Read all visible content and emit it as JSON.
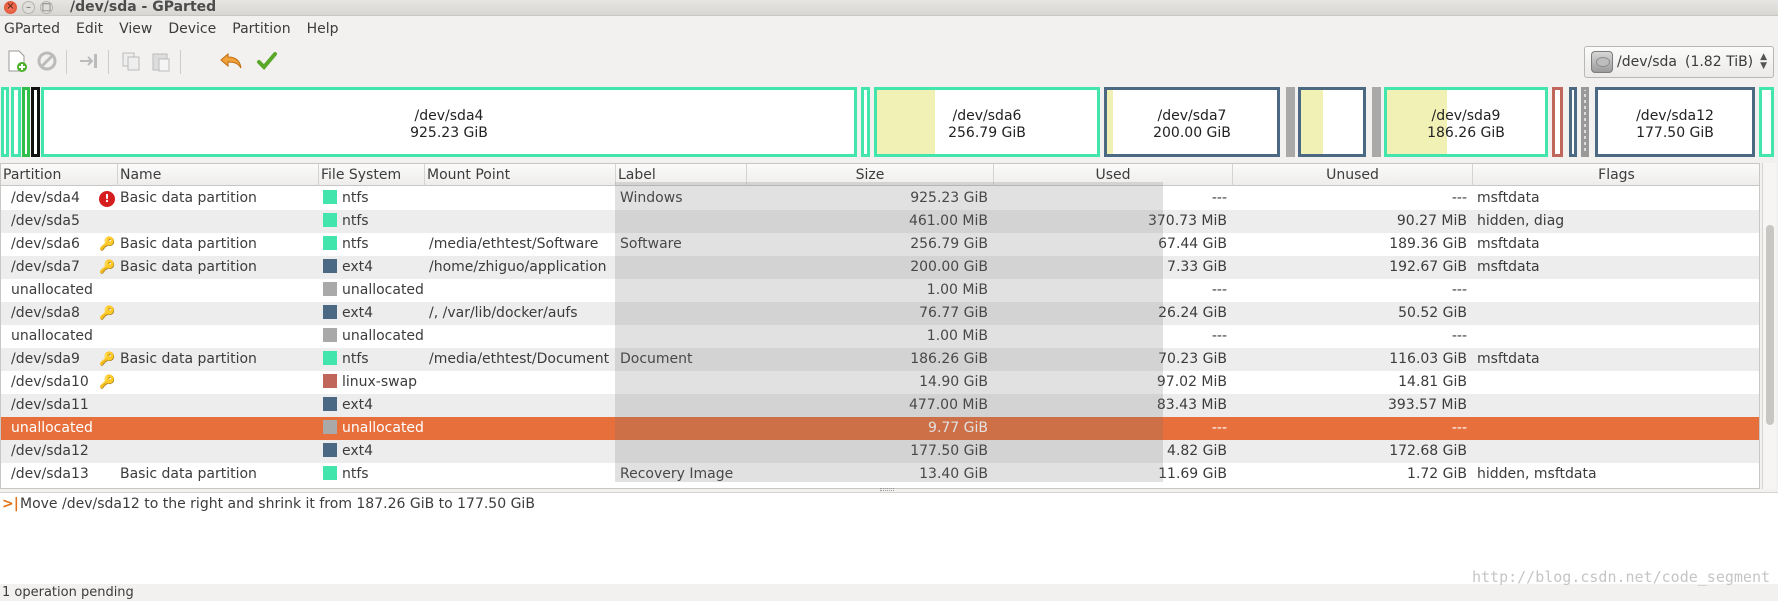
{
  "window": {
    "title": "/dev/sda - GParted"
  },
  "menu": [
    "GParted",
    "Edit",
    "View",
    "Device",
    "Partition",
    "Help"
  ],
  "device": {
    "name": "/dev/sda",
    "size": "(1.82 TiB)"
  },
  "map": {
    "sda4": {
      "name": "/dev/sda4",
      "size": "925.23 GiB"
    },
    "sda6": {
      "name": "/dev/sda6",
      "size": "256.79 GiB"
    },
    "sda7": {
      "name": "/dev/sda7",
      "size": "200.00 GiB"
    },
    "sda9": {
      "name": "/dev/sda9",
      "size": "186.26 GiB"
    },
    "sda12": {
      "name": "/dev/sda12",
      "size": "177.50 GiB"
    }
  },
  "columns": {
    "partition": "Partition",
    "name": "Name",
    "fs": "File System",
    "mount": "Mount Point",
    "label": "Label",
    "size": "Size",
    "used": "Used",
    "unused": "Unused",
    "flags": "Flags"
  },
  "rows": [
    {
      "partition": "/dev/sda4",
      "name": "Basic data partition",
      "fs": "ntfs",
      "mount": "",
      "label": "Windows",
      "size": "925.23 GiB",
      "used": "---",
      "unused": "---",
      "flags": "msftdata"
    },
    {
      "partition": "/dev/sda5",
      "name": "",
      "fs": "ntfs",
      "mount": "",
      "label": "",
      "size": "461.00 MiB",
      "used": "370.73 MiB",
      "unused": "90.27 MiB",
      "flags": "hidden, diag"
    },
    {
      "partition": "/dev/sda6",
      "name": "Basic data partition",
      "fs": "ntfs",
      "mount": "/media/ethtest/Software",
      "label": "Software",
      "size": "256.79 GiB",
      "used": "67.44 GiB",
      "unused": "189.36 GiB",
      "flags": "msftdata"
    },
    {
      "partition": "/dev/sda7",
      "name": "Basic data partition",
      "fs": "ext4",
      "mount": "/home/zhiguo/application",
      "label": "",
      "size": "200.00 GiB",
      "used": "7.33 GiB",
      "unused": "192.67 GiB",
      "flags": "msftdata"
    },
    {
      "partition": "unallocated",
      "name": "",
      "fs": "unallocated",
      "mount": "",
      "label": "",
      "size": "1.00 MiB",
      "used": "---",
      "unused": "---",
      "flags": ""
    },
    {
      "partition": "/dev/sda8",
      "name": "",
      "fs": "ext4",
      "mount": "/, /var/lib/docker/aufs",
      "label": "",
      "size": "76.77 GiB",
      "used": "26.24 GiB",
      "unused": "50.52 GiB",
      "flags": ""
    },
    {
      "partition": "unallocated",
      "name": "",
      "fs": "unallocated",
      "mount": "",
      "label": "",
      "size": "1.00 MiB",
      "used": "---",
      "unused": "---",
      "flags": ""
    },
    {
      "partition": "/dev/sda9",
      "name": "Basic data partition",
      "fs": "ntfs",
      "mount": "/media/ethtest/Document",
      "label": "Document",
      "size": "186.26 GiB",
      "used": "70.23 GiB",
      "unused": "116.03 GiB",
      "flags": "msftdata"
    },
    {
      "partition": "/dev/sda10",
      "name": "",
      "fs": "linux-swap",
      "mount": "",
      "label": "",
      "size": "14.90 GiB",
      "used": "97.02 MiB",
      "unused": "14.81 GiB",
      "flags": ""
    },
    {
      "partition": "/dev/sda11",
      "name": "",
      "fs": "ext4",
      "mount": "",
      "label": "",
      "size": "477.00 MiB",
      "used": "83.43 MiB",
      "unused": "393.57 MiB",
      "flags": ""
    },
    {
      "partition": "unallocated",
      "name": "",
      "fs": "unallocated",
      "mount": "",
      "label": "",
      "size": "9.77 GiB",
      "used": "---",
      "unused": "---",
      "flags": ""
    },
    {
      "partition": "/dev/sda12",
      "name": "",
      "fs": "ext4",
      "mount": "",
      "label": "",
      "size": "177.50 GiB",
      "used": "4.82 GiB",
      "unused": "172.68 GiB",
      "flags": ""
    },
    {
      "partition": "/dev/sda13",
      "name": "Basic data partition",
      "fs": "ntfs",
      "mount": "",
      "label": "Recovery Image",
      "size": "13.40 GiB",
      "used": "11.69 GiB",
      "unused": "1.72 GiB",
      "flags": "hidden, msftdata"
    }
  ],
  "fs_colors": {
    "ntfs": "#42e5ac",
    "ext4": "#4b6983",
    "unallocated": "#a9a9a9",
    "linux-swap": "#c1665a"
  },
  "selection_color": "#e66f3c",
  "operations": [
    "Move /dev/sda12 to the right and shrink it from 187.26 GiB to 177.50 GiB"
  ],
  "status": "1 operation pending",
  "watermark": "http://blog.csdn.net/code_segment"
}
